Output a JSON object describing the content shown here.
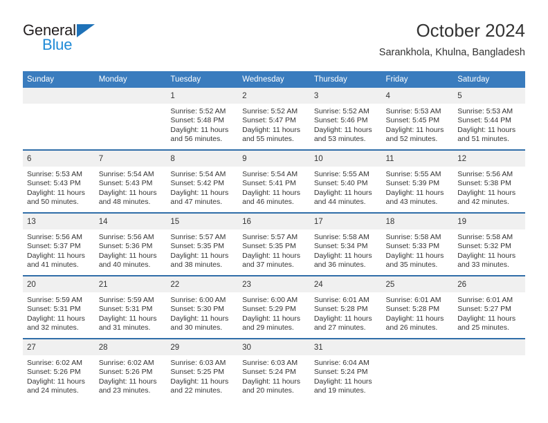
{
  "brand": {
    "name_top": "General",
    "name_bottom": "Blue",
    "accent_color": "#1f72b8",
    "accent_color_light": "#1f8ad6"
  },
  "header": {
    "title": "October 2024",
    "subtitle": "Sarankhola, Khulna, Bangladesh"
  },
  "theme": {
    "header_row_bg": "#3a7cbe",
    "row_separator": "#2f6da8",
    "daynum_band_bg": "#f0f0f0",
    "text_color": "#333333"
  },
  "weekdays": [
    "Sunday",
    "Monday",
    "Tuesday",
    "Wednesday",
    "Thursday",
    "Friday",
    "Saturday"
  ],
  "weeks": [
    [
      {
        "day": "",
        "sunrise": "",
        "sunset": "",
        "daylight_line1": "",
        "daylight_line2": ""
      },
      {
        "day": "",
        "sunrise": "",
        "sunset": "",
        "daylight_line1": "",
        "daylight_line2": ""
      },
      {
        "day": "1",
        "sunrise": "Sunrise: 5:52 AM",
        "sunset": "Sunset: 5:48 PM",
        "daylight_line1": "Daylight: 11 hours",
        "daylight_line2": "and 56 minutes."
      },
      {
        "day": "2",
        "sunrise": "Sunrise: 5:52 AM",
        "sunset": "Sunset: 5:47 PM",
        "daylight_line1": "Daylight: 11 hours",
        "daylight_line2": "and 55 minutes."
      },
      {
        "day": "3",
        "sunrise": "Sunrise: 5:52 AM",
        "sunset": "Sunset: 5:46 PM",
        "daylight_line1": "Daylight: 11 hours",
        "daylight_line2": "and 53 minutes."
      },
      {
        "day": "4",
        "sunrise": "Sunrise: 5:53 AM",
        "sunset": "Sunset: 5:45 PM",
        "daylight_line1": "Daylight: 11 hours",
        "daylight_line2": "and 52 minutes."
      },
      {
        "day": "5",
        "sunrise": "Sunrise: 5:53 AM",
        "sunset": "Sunset: 5:44 PM",
        "daylight_line1": "Daylight: 11 hours",
        "daylight_line2": "and 51 minutes."
      }
    ],
    [
      {
        "day": "6",
        "sunrise": "Sunrise: 5:53 AM",
        "sunset": "Sunset: 5:43 PM",
        "daylight_line1": "Daylight: 11 hours",
        "daylight_line2": "and 50 minutes."
      },
      {
        "day": "7",
        "sunrise": "Sunrise: 5:54 AM",
        "sunset": "Sunset: 5:43 PM",
        "daylight_line1": "Daylight: 11 hours",
        "daylight_line2": "and 48 minutes."
      },
      {
        "day": "8",
        "sunrise": "Sunrise: 5:54 AM",
        "sunset": "Sunset: 5:42 PM",
        "daylight_line1": "Daylight: 11 hours",
        "daylight_line2": "and 47 minutes."
      },
      {
        "day": "9",
        "sunrise": "Sunrise: 5:54 AM",
        "sunset": "Sunset: 5:41 PM",
        "daylight_line1": "Daylight: 11 hours",
        "daylight_line2": "and 46 minutes."
      },
      {
        "day": "10",
        "sunrise": "Sunrise: 5:55 AM",
        "sunset": "Sunset: 5:40 PM",
        "daylight_line1": "Daylight: 11 hours",
        "daylight_line2": "and 44 minutes."
      },
      {
        "day": "11",
        "sunrise": "Sunrise: 5:55 AM",
        "sunset": "Sunset: 5:39 PM",
        "daylight_line1": "Daylight: 11 hours",
        "daylight_line2": "and 43 minutes."
      },
      {
        "day": "12",
        "sunrise": "Sunrise: 5:56 AM",
        "sunset": "Sunset: 5:38 PM",
        "daylight_line1": "Daylight: 11 hours",
        "daylight_line2": "and 42 minutes."
      }
    ],
    [
      {
        "day": "13",
        "sunrise": "Sunrise: 5:56 AM",
        "sunset": "Sunset: 5:37 PM",
        "daylight_line1": "Daylight: 11 hours",
        "daylight_line2": "and 41 minutes."
      },
      {
        "day": "14",
        "sunrise": "Sunrise: 5:56 AM",
        "sunset": "Sunset: 5:36 PM",
        "daylight_line1": "Daylight: 11 hours",
        "daylight_line2": "and 40 minutes."
      },
      {
        "day": "15",
        "sunrise": "Sunrise: 5:57 AM",
        "sunset": "Sunset: 5:35 PM",
        "daylight_line1": "Daylight: 11 hours",
        "daylight_line2": "and 38 minutes."
      },
      {
        "day": "16",
        "sunrise": "Sunrise: 5:57 AM",
        "sunset": "Sunset: 5:35 PM",
        "daylight_line1": "Daylight: 11 hours",
        "daylight_line2": "and 37 minutes."
      },
      {
        "day": "17",
        "sunrise": "Sunrise: 5:58 AM",
        "sunset": "Sunset: 5:34 PM",
        "daylight_line1": "Daylight: 11 hours",
        "daylight_line2": "and 36 minutes."
      },
      {
        "day": "18",
        "sunrise": "Sunrise: 5:58 AM",
        "sunset": "Sunset: 5:33 PM",
        "daylight_line1": "Daylight: 11 hours",
        "daylight_line2": "and 35 minutes."
      },
      {
        "day": "19",
        "sunrise": "Sunrise: 5:58 AM",
        "sunset": "Sunset: 5:32 PM",
        "daylight_line1": "Daylight: 11 hours",
        "daylight_line2": "and 33 minutes."
      }
    ],
    [
      {
        "day": "20",
        "sunrise": "Sunrise: 5:59 AM",
        "sunset": "Sunset: 5:31 PM",
        "daylight_line1": "Daylight: 11 hours",
        "daylight_line2": "and 32 minutes."
      },
      {
        "day": "21",
        "sunrise": "Sunrise: 5:59 AM",
        "sunset": "Sunset: 5:31 PM",
        "daylight_line1": "Daylight: 11 hours",
        "daylight_line2": "and 31 minutes."
      },
      {
        "day": "22",
        "sunrise": "Sunrise: 6:00 AM",
        "sunset": "Sunset: 5:30 PM",
        "daylight_line1": "Daylight: 11 hours",
        "daylight_line2": "and 30 minutes."
      },
      {
        "day": "23",
        "sunrise": "Sunrise: 6:00 AM",
        "sunset": "Sunset: 5:29 PM",
        "daylight_line1": "Daylight: 11 hours",
        "daylight_line2": "and 29 minutes."
      },
      {
        "day": "24",
        "sunrise": "Sunrise: 6:01 AM",
        "sunset": "Sunset: 5:28 PM",
        "daylight_line1": "Daylight: 11 hours",
        "daylight_line2": "and 27 minutes."
      },
      {
        "day": "25",
        "sunrise": "Sunrise: 6:01 AM",
        "sunset": "Sunset: 5:28 PM",
        "daylight_line1": "Daylight: 11 hours",
        "daylight_line2": "and 26 minutes."
      },
      {
        "day": "26",
        "sunrise": "Sunrise: 6:01 AM",
        "sunset": "Sunset: 5:27 PM",
        "daylight_line1": "Daylight: 11 hours",
        "daylight_line2": "and 25 minutes."
      }
    ],
    [
      {
        "day": "27",
        "sunrise": "Sunrise: 6:02 AM",
        "sunset": "Sunset: 5:26 PM",
        "daylight_line1": "Daylight: 11 hours",
        "daylight_line2": "and 24 minutes."
      },
      {
        "day": "28",
        "sunrise": "Sunrise: 6:02 AM",
        "sunset": "Sunset: 5:26 PM",
        "daylight_line1": "Daylight: 11 hours",
        "daylight_line2": "and 23 minutes."
      },
      {
        "day": "29",
        "sunrise": "Sunrise: 6:03 AM",
        "sunset": "Sunset: 5:25 PM",
        "daylight_line1": "Daylight: 11 hours",
        "daylight_line2": "and 22 minutes."
      },
      {
        "day": "30",
        "sunrise": "Sunrise: 6:03 AM",
        "sunset": "Sunset: 5:24 PM",
        "daylight_line1": "Daylight: 11 hours",
        "daylight_line2": "and 20 minutes."
      },
      {
        "day": "31",
        "sunrise": "Sunrise: 6:04 AM",
        "sunset": "Sunset: 5:24 PM",
        "daylight_line1": "Daylight: 11 hours",
        "daylight_line2": "and 19 minutes."
      },
      {
        "day": "",
        "sunrise": "",
        "sunset": "",
        "daylight_line1": "",
        "daylight_line2": ""
      },
      {
        "day": "",
        "sunrise": "",
        "sunset": "",
        "daylight_line1": "",
        "daylight_line2": ""
      }
    ]
  ]
}
